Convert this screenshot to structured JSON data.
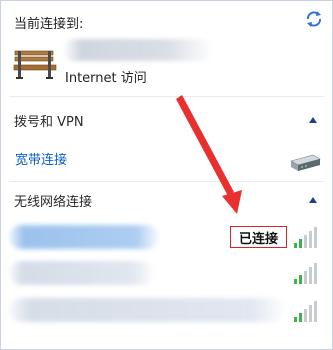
{
  "current": {
    "label": "当前连接到:",
    "access": "Internet 访问"
  },
  "dialup": {
    "header": "拨号和 VPN",
    "broadband": "宽带连接"
  },
  "wireless": {
    "header": "无线网络连接",
    "connected_label": "已连接"
  },
  "colors": {
    "link": "#0a5fc8",
    "annotation": "#d9252a",
    "signal": "#3cb44a"
  },
  "icons": {
    "refresh": "refresh-network-icon",
    "network": "bench-network-icon",
    "modem": "modem-icon",
    "collapse": "chevron-up-icon",
    "signal": "wifi-signal-icon"
  },
  "networks": [
    {
      "status": "connected",
      "signal_bars": 5
    },
    {
      "status": "available",
      "signal_bars": 5
    },
    {
      "status": "available",
      "signal_bars": 5
    }
  ]
}
